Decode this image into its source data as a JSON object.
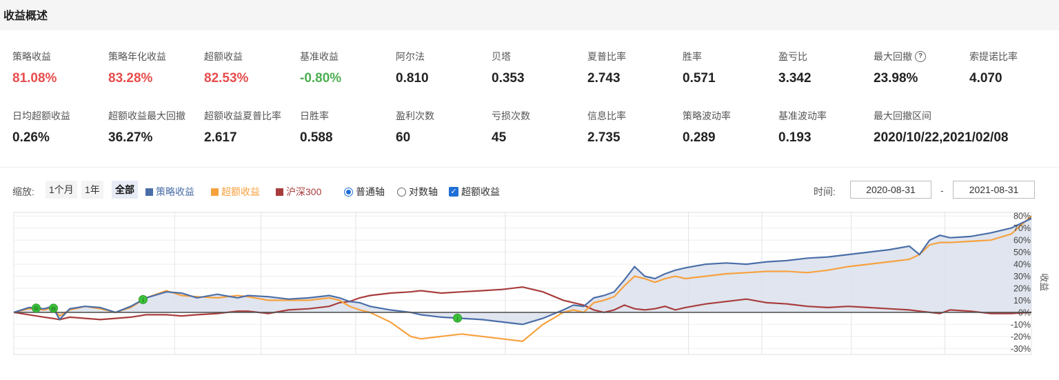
{
  "header": {
    "title": "收益概述"
  },
  "metrics_row1": [
    {
      "label": "策略收益",
      "value": "81.08%",
      "color": "red"
    },
    {
      "label": "策略年化收益",
      "value": "83.28%",
      "color": "red"
    },
    {
      "label": "超额收益",
      "value": "82.53%",
      "color": "red"
    },
    {
      "label": "基准收益",
      "value": "-0.80%",
      "color": "green"
    },
    {
      "label": "阿尔法",
      "value": "0.810"
    },
    {
      "label": "贝塔",
      "value": "0.353"
    },
    {
      "label": "夏普比率",
      "value": "2.743"
    },
    {
      "label": "胜率",
      "value": "0.571"
    },
    {
      "label": "盈亏比",
      "value": "3.342"
    },
    {
      "label": "最大回撤",
      "value": "23.98%",
      "help": "?"
    },
    {
      "label": "索提诺比率",
      "value": "4.070"
    }
  ],
  "metrics_row2": [
    {
      "label": "日均超额收益",
      "value": "0.26%"
    },
    {
      "label": "超额收益最大回撤",
      "value": "36.27%"
    },
    {
      "label": "超额收益夏普比率",
      "value": "2.617"
    },
    {
      "label": "日胜率",
      "value": "0.588"
    },
    {
      "label": "盈利次数",
      "value": "60"
    },
    {
      "label": "亏损次数",
      "value": "45"
    },
    {
      "label": "信息比率",
      "value": "2.735"
    },
    {
      "label": "策略波动率",
      "value": "0.289"
    },
    {
      "label": "基准波动率",
      "value": "0.193"
    },
    {
      "label": "最大回撤区间",
      "value": "2020/10/22,2021/02/08"
    }
  ],
  "toolbar": {
    "zoom_label": "缩放:",
    "zoom_1m": "1个月",
    "zoom_1y": "1年",
    "zoom_all": "全部",
    "legend_strategy": "策略收益",
    "legend_excess": "超额收益",
    "legend_benchmark": "沪深300",
    "axis_normal": "普通轴",
    "axis_log": "对数轴",
    "excess_toggle": "超额收益",
    "time_label": "时间:",
    "date_sep": "-",
    "start_date": "2020-08-31",
    "end_date": "2021-08-31"
  },
  "colors": {
    "strategy": "#4a6ea8",
    "excess": "#f7a13e",
    "benchmark": "#a83c3c",
    "fill": "#dbe1ec",
    "marker": "#3dc13c"
  },
  "chart_data": {
    "type": "line",
    "ylabel": "收益",
    "ylim": [
      -35,
      83
    ],
    "yticks": [
      "80%",
      "70%",
      "60%",
      "50%",
      "40%",
      "30%",
      "20%",
      "10%",
      "0%",
      "-10%",
      "-20%",
      "-30%"
    ],
    "yticks_values": [
      80,
      70,
      60,
      50,
      40,
      30,
      20,
      10,
      0,
      -10,
      -20,
      -30
    ],
    "x_range": [
      "2020-08-31",
      "2021-08-31"
    ],
    "series": [
      {
        "name": "策略收益",
        "key": "strategy",
        "x": [
          0,
          1.5,
          3,
          3.8,
          4.5,
          5.5,
          7,
          8.5,
          10,
          11.5,
          13,
          15,
          16.5,
          18,
          20,
          22,
          23,
          25,
          27,
          29,
          31,
          32,
          33,
          34,
          35,
          37,
          39,
          40,
          42,
          44,
          46,
          48,
          50,
          52,
          54,
          55,
          56,
          57,
          58,
          59,
          60,
          61,
          62,
          63,
          64,
          65,
          66,
          68,
          70,
          72,
          74,
          76,
          78,
          80,
          82,
          84,
          86,
          88,
          89,
          90,
          91,
          92,
          94,
          96,
          98,
          100
        ],
        "values": [
          0,
          4,
          3,
          5,
          -6,
          3,
          5,
          4,
          0,
          5,
          12,
          17,
          16,
          12,
          15,
          12,
          14,
          13,
          11,
          12,
          14,
          12,
          9,
          8,
          5,
          2,
          0,
          -2,
          -4,
          -5,
          -6,
          -8,
          -10,
          -5,
          2,
          6,
          5,
          12,
          14,
          17,
          27,
          38,
          30,
          28,
          32,
          35,
          37,
          40,
          41,
          40,
          42,
          43,
          45,
          46,
          48,
          50,
          52,
          55,
          48,
          60,
          64,
          62,
          63,
          66,
          70,
          78
        ]
      },
      {
        "name": "超额收益",
        "key": "excess",
        "x": [
          0,
          1.5,
          3,
          3.8,
          4.5,
          5.5,
          7,
          8.5,
          10,
          11.5,
          13,
          15,
          16.5,
          18,
          20,
          22,
          23,
          25,
          27,
          29,
          31,
          32,
          33,
          34,
          35,
          37,
          39,
          40,
          42,
          44,
          46,
          48,
          50,
          52,
          54,
          55,
          56,
          57,
          58,
          59,
          60,
          61,
          62,
          63,
          64,
          65,
          66,
          68,
          70,
          72,
          74,
          76,
          78,
          80,
          82,
          84,
          86,
          88,
          89,
          90,
          91,
          92,
          94,
          96,
          98,
          100
        ],
        "values": [
          0,
          3,
          2,
          4,
          -3,
          2,
          5,
          3,
          0,
          4,
          12,
          18,
          14,
          13,
          12,
          14,
          13,
          10,
          10,
          10,
          12,
          10,
          5,
          2,
          0,
          -8,
          -20,
          -22,
          -20,
          -18,
          -20,
          -22,
          -24,
          -10,
          0,
          2,
          0,
          8,
          10,
          13,
          22,
          30,
          28,
          25,
          28,
          30,
          28,
          30,
          32,
          33,
          34,
          34,
          33,
          35,
          38,
          40,
          42,
          44,
          48,
          56,
          58,
          58,
          59,
          60,
          65,
          80
        ]
      },
      {
        "name": "沪深300",
        "key": "benchmark",
        "x": [
          0,
          1.5,
          3,
          3.8,
          4.5,
          5.5,
          7,
          8.5,
          10,
          11.5,
          13,
          15,
          16.5,
          18,
          20,
          22,
          23,
          25,
          27,
          29,
          31,
          32,
          33,
          34,
          35,
          37,
          39,
          40,
          42,
          44,
          46,
          48,
          50,
          52,
          54,
          55,
          56,
          57,
          58,
          59,
          60,
          61,
          62,
          63,
          64,
          65,
          66,
          68,
          70,
          72,
          74,
          76,
          78,
          80,
          82,
          84,
          86,
          88,
          89,
          90,
          91,
          92,
          94,
          96,
          98,
          100
        ],
        "values": [
          0,
          -2,
          -4,
          -5,
          -6,
          -4,
          -5,
          -6,
          -5,
          -4,
          -2,
          -2,
          -3,
          -2,
          -1,
          1,
          1,
          -1,
          2,
          3,
          5,
          8,
          9,
          12,
          14,
          16,
          17,
          18,
          16,
          17,
          18,
          19,
          21,
          17,
          10,
          8,
          6,
          2,
          0,
          2,
          6,
          3,
          2,
          3,
          5,
          2,
          4,
          7,
          9,
          11,
          8,
          7,
          5,
          4,
          5,
          4,
          3,
          2,
          1,
          0,
          -1,
          2,
          1,
          -1,
          -1,
          0
        ]
      }
    ],
    "markers": [
      {
        "series": "strategy",
        "x": 2.2,
        "label": "⊖"
      },
      {
        "series": "strategy",
        "x": 3.9,
        "label": "⊖"
      },
      {
        "series": "strategy",
        "x": 12.7,
        "label": "i"
      },
      {
        "series": "strategy",
        "x": 43.6,
        "label": "i"
      }
    ]
  }
}
